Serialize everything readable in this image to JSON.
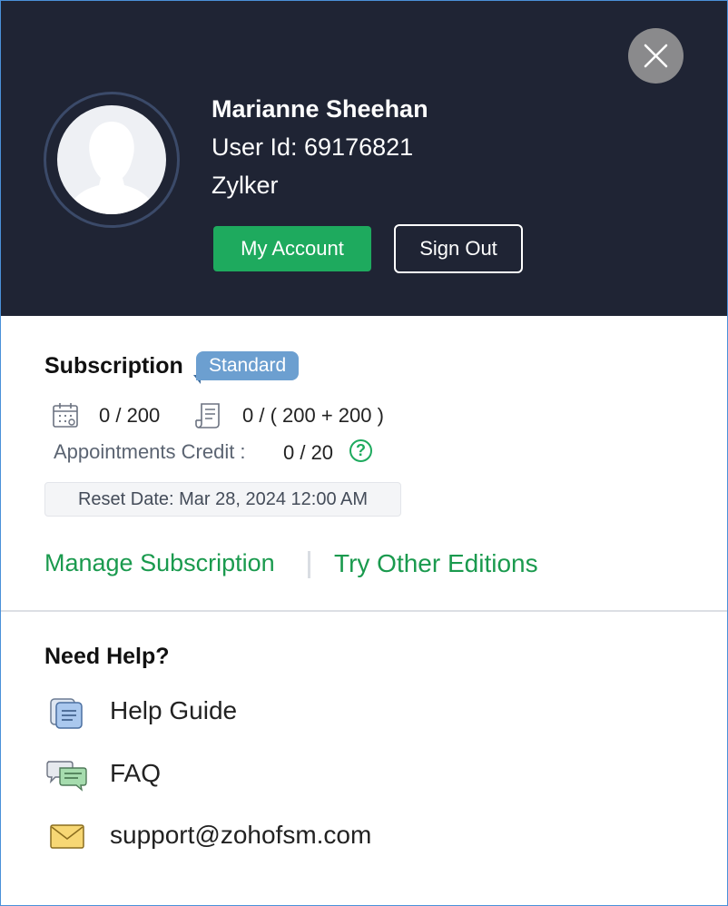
{
  "profile": {
    "name": "Marianne Sheehan",
    "user_id": "User Id: 69176821",
    "org": "Zylker",
    "my_account_label": "My Account",
    "sign_out_label": "Sign Out"
  },
  "subscription": {
    "title": "Subscription",
    "edition": "Standard",
    "usage1": "0 / 200",
    "usage2": "0 / ( 200 + 200 )",
    "appointments_label": "Appointments Credit :",
    "appointments_value": "0 / 20",
    "help_glyph": "?",
    "reset_date": "Reset Date: Mar 28, 2024 12:00 AM",
    "manage_label": "Manage Subscription",
    "try_label": "Try Other Editions"
  },
  "help": {
    "title": "Need Help?",
    "items": [
      {
        "label": "Help Guide",
        "icon": "help-guide-icon"
      },
      {
        "label": "FAQ",
        "icon": "faq-icon"
      },
      {
        "label": "support@zohofsm.com",
        "icon": "mail-icon"
      }
    ]
  },
  "colors": {
    "header_bg": "#1f2434",
    "accent_green": "#1eaa5e",
    "badge_blue": "#6c9fd0"
  }
}
